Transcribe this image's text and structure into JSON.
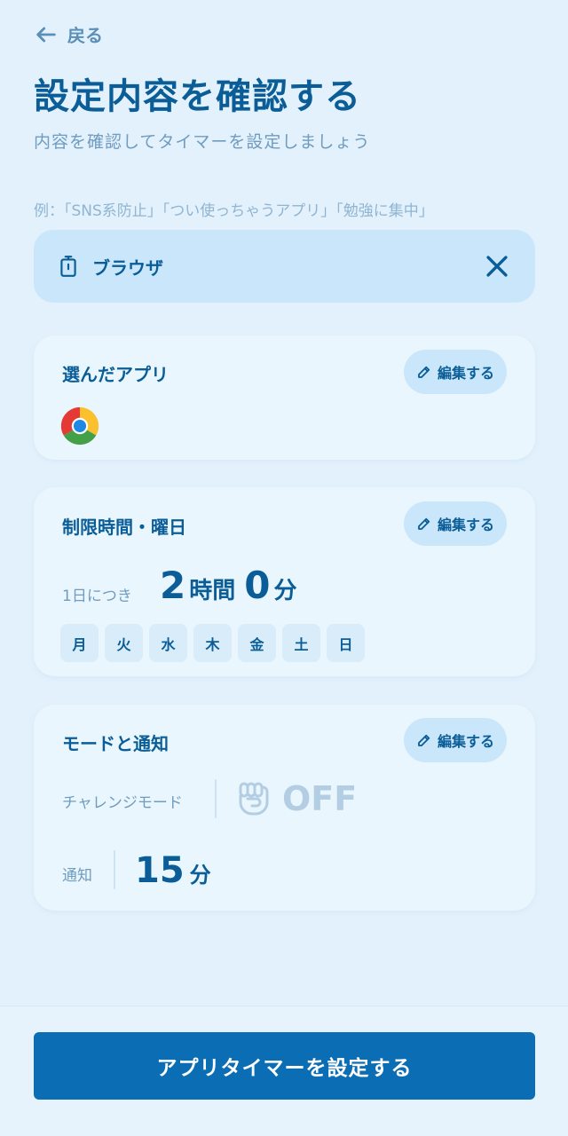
{
  "header": {
    "back_label": "戻る",
    "title": "設定内容を確認する",
    "subtitle": "内容を確認してタイマーを設定しましょう"
  },
  "name_field": {
    "example": "例：「SNS系防止」「つい使っちゃうアプリ」「勉強に集中」",
    "value": "ブラウザ",
    "icon": "timer-icon",
    "clear_icon": "close-icon"
  },
  "apps_card": {
    "title": "選んだアプリ",
    "edit_label": "編集する",
    "apps": [
      {
        "icon": "chrome-icon"
      }
    ]
  },
  "limit_card": {
    "title": "制限時間・曜日",
    "edit_label": "編集する",
    "per_day_label": "1日につき",
    "hours": "2",
    "hours_unit": "時間",
    "minutes": "0",
    "minutes_unit": "分",
    "days": [
      "月",
      "火",
      "水",
      "木",
      "金",
      "土",
      "日"
    ]
  },
  "mode_card": {
    "title": "モードと通知",
    "edit_label": "編集する",
    "challenge_label": "チャレンジモード",
    "challenge_value": "OFF",
    "notify_label": "通知",
    "notify_value": "15",
    "notify_unit": "分"
  },
  "footer": {
    "submit_label": "アプリタイマーを設定する"
  },
  "colors": {
    "accent": "#0b6db3",
    "text": "#0a5d96",
    "background": "#e3f1fc",
    "card": "#eaf6fd",
    "chip": "#c9e6fb"
  }
}
